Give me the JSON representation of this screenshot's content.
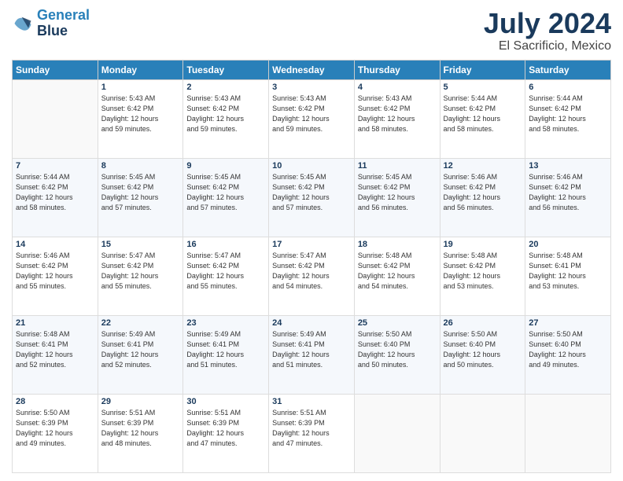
{
  "header": {
    "month_year": "July 2024",
    "location": "El Sacrificio, Mexico"
  },
  "weekdays": [
    "Sunday",
    "Monday",
    "Tuesday",
    "Wednesday",
    "Thursday",
    "Friday",
    "Saturday"
  ],
  "weeks": [
    [
      {
        "day": "",
        "sunrise": "",
        "sunset": "",
        "daylight": ""
      },
      {
        "day": "1",
        "sunrise": "Sunrise: 5:43 AM",
        "sunset": "Sunset: 6:42 PM",
        "daylight": "Daylight: 12 hours and 59 minutes."
      },
      {
        "day": "2",
        "sunrise": "Sunrise: 5:43 AM",
        "sunset": "Sunset: 6:42 PM",
        "daylight": "Daylight: 12 hours and 59 minutes."
      },
      {
        "day": "3",
        "sunrise": "Sunrise: 5:43 AM",
        "sunset": "Sunset: 6:42 PM",
        "daylight": "Daylight: 12 hours and 59 minutes."
      },
      {
        "day": "4",
        "sunrise": "Sunrise: 5:43 AM",
        "sunset": "Sunset: 6:42 PM",
        "daylight": "Daylight: 12 hours and 58 minutes."
      },
      {
        "day": "5",
        "sunrise": "Sunrise: 5:44 AM",
        "sunset": "Sunset: 6:42 PM",
        "daylight": "Daylight: 12 hours and 58 minutes."
      },
      {
        "day": "6",
        "sunrise": "Sunrise: 5:44 AM",
        "sunset": "Sunset: 6:42 PM",
        "daylight": "Daylight: 12 hours and 58 minutes."
      }
    ],
    [
      {
        "day": "7",
        "sunrise": "Sunrise: 5:44 AM",
        "sunset": "Sunset: 6:42 PM",
        "daylight": "Daylight: 12 hours and 58 minutes."
      },
      {
        "day": "8",
        "sunrise": "Sunrise: 5:45 AM",
        "sunset": "Sunset: 6:42 PM",
        "daylight": "Daylight: 12 hours and 57 minutes."
      },
      {
        "day": "9",
        "sunrise": "Sunrise: 5:45 AM",
        "sunset": "Sunset: 6:42 PM",
        "daylight": "Daylight: 12 hours and 57 minutes."
      },
      {
        "day": "10",
        "sunrise": "Sunrise: 5:45 AM",
        "sunset": "Sunset: 6:42 PM",
        "daylight": "Daylight: 12 hours and 57 minutes."
      },
      {
        "day": "11",
        "sunrise": "Sunrise: 5:45 AM",
        "sunset": "Sunset: 6:42 PM",
        "daylight": "Daylight: 12 hours and 56 minutes."
      },
      {
        "day": "12",
        "sunrise": "Sunrise: 5:46 AM",
        "sunset": "Sunset: 6:42 PM",
        "daylight": "Daylight: 12 hours and 56 minutes."
      },
      {
        "day": "13",
        "sunrise": "Sunrise: 5:46 AM",
        "sunset": "Sunset: 6:42 PM",
        "daylight": "Daylight: 12 hours and 56 minutes."
      }
    ],
    [
      {
        "day": "14",
        "sunrise": "Sunrise: 5:46 AM",
        "sunset": "Sunset: 6:42 PM",
        "daylight": "Daylight: 12 hours and 55 minutes."
      },
      {
        "day": "15",
        "sunrise": "Sunrise: 5:47 AM",
        "sunset": "Sunset: 6:42 PM",
        "daylight": "Daylight: 12 hours and 55 minutes."
      },
      {
        "day": "16",
        "sunrise": "Sunrise: 5:47 AM",
        "sunset": "Sunset: 6:42 PM",
        "daylight": "Daylight: 12 hours and 55 minutes."
      },
      {
        "day": "17",
        "sunrise": "Sunrise: 5:47 AM",
        "sunset": "Sunset: 6:42 PM",
        "daylight": "Daylight: 12 hours and 54 minutes."
      },
      {
        "day": "18",
        "sunrise": "Sunrise: 5:48 AM",
        "sunset": "Sunset: 6:42 PM",
        "daylight": "Daylight: 12 hours and 54 minutes."
      },
      {
        "day": "19",
        "sunrise": "Sunrise: 5:48 AM",
        "sunset": "Sunset: 6:42 PM",
        "daylight": "Daylight: 12 hours and 53 minutes."
      },
      {
        "day": "20",
        "sunrise": "Sunrise: 5:48 AM",
        "sunset": "Sunset: 6:41 PM",
        "daylight": "Daylight: 12 hours and 53 minutes."
      }
    ],
    [
      {
        "day": "21",
        "sunrise": "Sunrise: 5:48 AM",
        "sunset": "Sunset: 6:41 PM",
        "daylight": "Daylight: 12 hours and 52 minutes."
      },
      {
        "day": "22",
        "sunrise": "Sunrise: 5:49 AM",
        "sunset": "Sunset: 6:41 PM",
        "daylight": "Daylight: 12 hours and 52 minutes."
      },
      {
        "day": "23",
        "sunrise": "Sunrise: 5:49 AM",
        "sunset": "Sunset: 6:41 PM",
        "daylight": "Daylight: 12 hours and 51 minutes."
      },
      {
        "day": "24",
        "sunrise": "Sunrise: 5:49 AM",
        "sunset": "Sunset: 6:41 PM",
        "daylight": "Daylight: 12 hours and 51 minutes."
      },
      {
        "day": "25",
        "sunrise": "Sunrise: 5:50 AM",
        "sunset": "Sunset: 6:40 PM",
        "daylight": "Daylight: 12 hours and 50 minutes."
      },
      {
        "day": "26",
        "sunrise": "Sunrise: 5:50 AM",
        "sunset": "Sunset: 6:40 PM",
        "daylight": "Daylight: 12 hours and 50 minutes."
      },
      {
        "day": "27",
        "sunrise": "Sunrise: 5:50 AM",
        "sunset": "Sunset: 6:40 PM",
        "daylight": "Daylight: 12 hours and 49 minutes."
      }
    ],
    [
      {
        "day": "28",
        "sunrise": "Sunrise: 5:50 AM",
        "sunset": "Sunset: 6:39 PM",
        "daylight": "Daylight: 12 hours and 49 minutes."
      },
      {
        "day": "29",
        "sunrise": "Sunrise: 5:51 AM",
        "sunset": "Sunset: 6:39 PM",
        "daylight": "Daylight: 12 hours and 48 minutes."
      },
      {
        "day": "30",
        "sunrise": "Sunrise: 5:51 AM",
        "sunset": "Sunset: 6:39 PM",
        "daylight": "Daylight: 12 hours and 47 minutes."
      },
      {
        "day": "31",
        "sunrise": "Sunrise: 5:51 AM",
        "sunset": "Sunset: 6:39 PM",
        "daylight": "Daylight: 12 hours and 47 minutes."
      },
      {
        "day": "",
        "sunrise": "",
        "sunset": "",
        "daylight": ""
      },
      {
        "day": "",
        "sunrise": "",
        "sunset": "",
        "daylight": ""
      },
      {
        "day": "",
        "sunrise": "",
        "sunset": "",
        "daylight": ""
      }
    ]
  ]
}
